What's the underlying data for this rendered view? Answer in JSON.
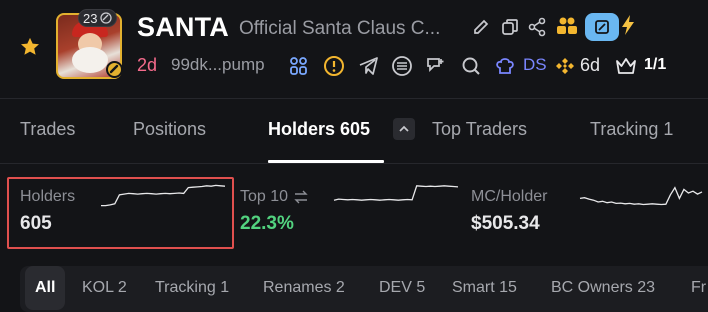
{
  "token": {
    "ticker": "SANTA",
    "name": "Official Santa Claus C...",
    "age_badge": "23",
    "age": "2d",
    "address": "99dk...pump",
    "ds_label": "DS",
    "days": "6d",
    "ratio": "1/1"
  },
  "tabs": [
    {
      "label": "Trades"
    },
    {
      "label": "Positions"
    },
    {
      "label": "Holders 605"
    },
    {
      "label": "Top Traders"
    },
    {
      "label": "Tracking 1"
    }
  ],
  "stats": {
    "holders": {
      "label": "Holders",
      "value": "605",
      "trend": [
        0.4,
        0.4,
        0.42,
        0.45,
        0.7,
        0.72,
        0.74,
        0.73,
        0.72,
        0.73,
        0.74,
        0.73,
        0.72,
        0.73,
        0.74,
        0.73,
        0.74,
        0.75,
        0.74,
        0.9,
        0.91,
        0.92,
        0.93,
        0.95,
        0.94,
        0.96,
        0.95,
        0.94
      ]
    },
    "top10": {
      "label": "Top 10",
      "value": "22.3%",
      "trend": [
        0.55,
        0.58,
        0.57,
        0.56,
        0.57,
        0.56,
        0.55,
        0.56,
        0.57,
        0.56,
        0.55,
        0.56,
        0.57,
        0.56,
        0.55,
        0.56,
        0.57,
        0.56,
        0.95,
        0.94,
        0.93,
        0.94,
        0.93,
        0.94,
        0.95,
        0.94,
        0.93,
        0.92
      ]
    },
    "mc_holder": {
      "label": "MC/Holder",
      "value": "$505.34",
      "trend": [
        0.6,
        0.62,
        0.58,
        0.55,
        0.5,
        0.52,
        0.48,
        0.5,
        0.46,
        0.47,
        0.45,
        0.46,
        0.44,
        0.45,
        0.43,
        0.44,
        0.45,
        0.44,
        0.43,
        0.44,
        0.7,
        0.9,
        0.6,
        0.85,
        0.75,
        0.8,
        0.72,
        0.78
      ]
    }
  },
  "filters": [
    {
      "label": "All"
    },
    {
      "label": "KOL 2"
    },
    {
      "label": "Tracking 1"
    },
    {
      "label": "Renames 2"
    },
    {
      "label": "DEV 5"
    },
    {
      "label": "Smart 15"
    },
    {
      "label": "BC Owners 23"
    },
    {
      "label": "Fr"
    }
  ],
  "colors": {
    "age": "#f56b8c",
    "ds": "#7a86ff",
    "top10_value": "#52d27f",
    "highlight": "#e0504e",
    "star": "#f3b62f"
  },
  "icons": [
    "star-icon",
    "edit-icon",
    "copy-icon",
    "share-icon",
    "holders-icon",
    "message-icon",
    "bolt-icon",
    "bundle-icon",
    "alert-icon",
    "telegram-icon",
    "website-icon",
    "note-icon",
    "search-icon",
    "chef-icon",
    "binance-icon",
    "crown-icon",
    "swap-icon",
    "chevron-up-icon"
  ]
}
